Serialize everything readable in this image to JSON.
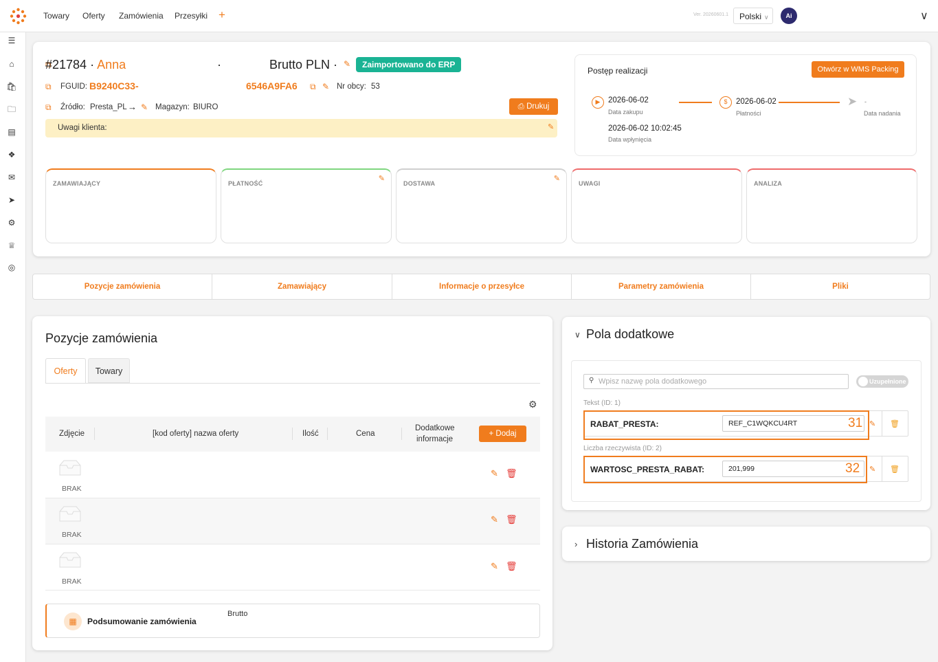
{
  "nav": {
    "items": [
      "Towary",
      "Oferty",
      "Zamówienia",
      "Przesyłki"
    ],
    "plus": "+",
    "version": "Ver. 20260601.1",
    "language": "Polski",
    "avatar": "Ai"
  },
  "sidebar": {
    "icons": [
      "menu-icon",
      "home-icon",
      "bag-icon",
      "folder-icon",
      "document-icon",
      "dropbox-icon",
      "mail-icon",
      "rocket-icon",
      "settings-icon",
      "crown-icon",
      "support-icon"
    ]
  },
  "header": {
    "order_number": "#21784",
    "customer_name": "Anna",
    "brutto": "Brutto PLN",
    "badge": "Zaimportowano do ERP",
    "fguid_label": "FGUID:",
    "fguid_part1": "B9240C33-",
    "fguid_part2": "6546A9FA6",
    "nr_obcy_label": "Nr obcy:",
    "nr_obcy_value": "53",
    "source_label": "Źródło:",
    "source_value": "Presta_PL",
    "magazyn_label": "Magazyn:",
    "magazyn_value": "BIURO",
    "print_label": "Drukuj",
    "notes_label": "Uwagi klienta:"
  },
  "progress": {
    "title": "Postęp realizacji",
    "wms_button": "Otwórz w WMS Packing",
    "purchase_date": "2026-06-02",
    "purchase_label": "Data zakupu",
    "payment_date": "2026-06-02",
    "payment_label": "Płatności",
    "send_value": "-",
    "send_label": "Data nadania",
    "inflow_date": "2026-06-02 10:02:45",
    "inflow_label": "Data wpłynięcia"
  },
  "sections": [
    {
      "title": "ZAMAWIAJĄCY",
      "color": "#f07c1d",
      "editable": false
    },
    {
      "title": "PŁATNOŚĆ",
      "color": "#7ed67e",
      "editable": true
    },
    {
      "title": "DOSTAWA",
      "color": "#cfcfcf",
      "editable": true
    },
    {
      "title": "UWAGI",
      "color": "#ee6a6a",
      "editable": false
    },
    {
      "title": "ANALIZA",
      "color": "#ee6a6a",
      "editable": false
    }
  ],
  "tabs": [
    "Pozycje zamówienia",
    "Zamawiający",
    "Informacje o przesyłce",
    "Parametry zamówienia",
    "Pliki"
  ],
  "positions": {
    "title": "Pozycje zamówienia",
    "subtabs": [
      "Oferty",
      "Towary"
    ],
    "columns": {
      "photo": "Zdjęcie",
      "name": "[kod oferty] nazwa oferty",
      "qty": "Ilość",
      "price": "Cena",
      "extra_1": "Dodatkowe",
      "extra_2": "informacje"
    },
    "add_button": "Dodaj",
    "rows": [
      {
        "photo_label": "BRAK"
      },
      {
        "photo_label": "BRAK"
      },
      {
        "photo_label": "BRAK"
      }
    ],
    "summary_label": "Podsumowanie zamówienia",
    "summary_brutto": "Brutto"
  },
  "extra_fields": {
    "title": "Pola dodatkowe",
    "search_placeholder": "Wpisz nazwę pola dodatkowego",
    "toggle_label": "Uzupełnione",
    "fields": [
      {
        "meta": "Tekst (ID: 1)",
        "name": "RABAT_PRESTA:",
        "value": "REF_C1WQKCU4RT",
        "marker": "31"
      },
      {
        "meta": "Liczba rzeczywista (ID: 2)",
        "name": "WARTOSC_PRESTA_RABAT:",
        "value": "201,999",
        "marker": "32"
      }
    ]
  },
  "history": {
    "title": "Historia Zamówienia"
  }
}
